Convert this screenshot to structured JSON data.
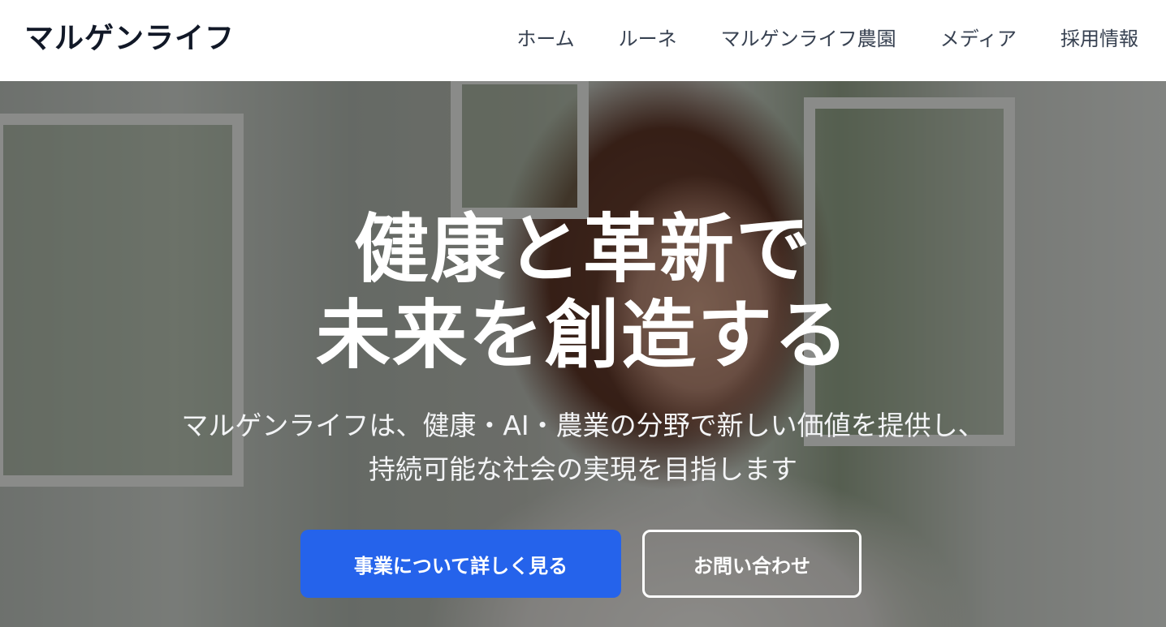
{
  "header": {
    "logo": "マルゲンライフ",
    "nav": [
      {
        "label": "ホーム"
      },
      {
        "label": "ルーネ"
      },
      {
        "label": "マルゲンライフ農園"
      },
      {
        "label": "メディア"
      },
      {
        "label": "採用情報"
      }
    ]
  },
  "hero": {
    "title_lines": [
      "健康と革新で",
      "未来を創造する"
    ],
    "subtitle_lines": [
      "マルゲンライフは、健康・AI・農業の分野で新しい価値を提供し、",
      "持続可能な社会の実現を目指します"
    ],
    "primary_button": "事業について詳しく見る",
    "secondary_button": "お問い合わせ"
  },
  "colors": {
    "accent": "#2563eb",
    "header_bg": "#ffffff",
    "nav_text": "#374151",
    "logo_text": "#111827"
  }
}
